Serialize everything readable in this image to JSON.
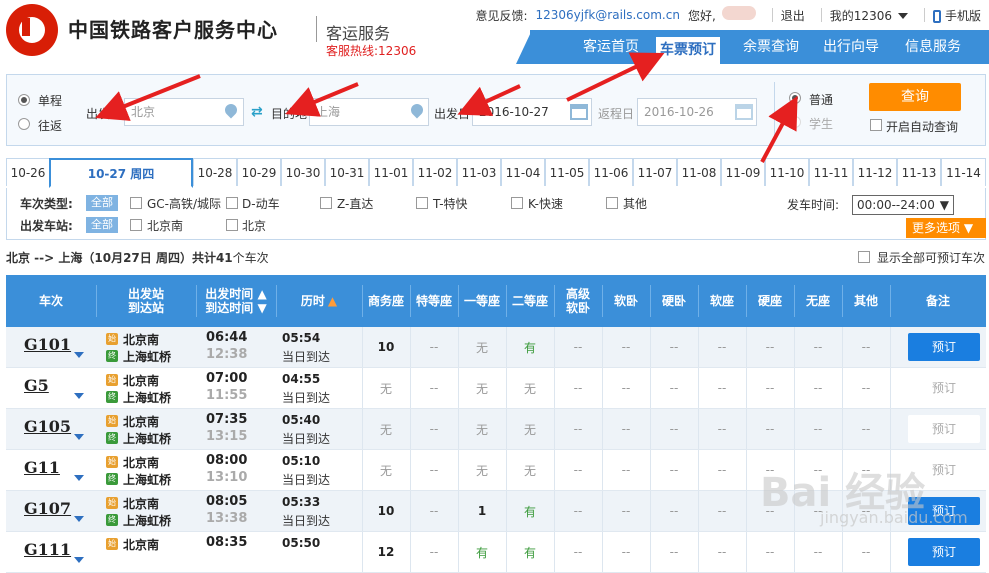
{
  "header": {
    "title": "中国铁路客户服务中心",
    "subtitle": "客运服务",
    "hotline": "客服热线:12306",
    "feedback_label": "意见反馈:",
    "feedback_email": "12306yjfk@rails.com.cn",
    "greeting": "您好,",
    "logout": "退出",
    "my12306": "我的12306",
    "mobile": "手机版"
  },
  "nav": {
    "items": [
      "客运首页",
      "车票预订",
      "余票查询",
      "出行向导",
      "信息服务"
    ],
    "active": "车票预订"
  },
  "search": {
    "trip_types": [
      "单程",
      "往返"
    ],
    "from_label": "出发地",
    "from_value": "北京",
    "to_label": "目的地",
    "to_value": "上海",
    "date_label": "出发日",
    "date_value": "2016-10-27",
    "return_label": "返程日",
    "return_value": "2016-10-26",
    "passenger_types": [
      "普通",
      "学生"
    ],
    "query_button": "查询",
    "auto_query": "开启自动查询"
  },
  "date_tabs": [
    "10-26",
    "10-27 周四",
    "10-28",
    "10-29",
    "10-30",
    "10-31",
    "11-01",
    "11-02",
    "11-03",
    "11-04",
    "11-05",
    "11-06",
    "11-07",
    "11-08",
    "11-09",
    "11-10",
    "11-11",
    "11-12",
    "11-13",
    "11-14"
  ],
  "filters": {
    "train_type_label": "车次类型:",
    "all": "全部",
    "train_types": [
      "GC-高铁/城际",
      "D-动车",
      "Z-直达",
      "T-特快",
      "K-快速",
      "其他"
    ],
    "station_label": "出发车站:",
    "stations": [
      "北京南",
      "北京"
    ],
    "time_label": "发车时间:",
    "time_value": "00:00--24:00",
    "more_options": "更多选项"
  },
  "summary": {
    "route": "北京 --> 上海（10月27日  周四）共计",
    "count": "41",
    "suffix": "个车次",
    "show_all": "显示全部可预订车次"
  },
  "table": {
    "headers": {
      "train": "车次",
      "station1": "出发站",
      "station2": "到达站",
      "time1": "出发时间",
      "time2": "到达时间",
      "duration": "历时",
      "seats": [
        "商务座",
        "特等座",
        "一等座",
        "二等座",
        "高级",
        "软卧",
        "软卧",
        "硬卧",
        "软座",
        "硬座",
        "无座",
        "其他"
      ],
      "note": "备注"
    },
    "rows": [
      {
        "train": "G101",
        "from": "北京南",
        "to": "上海虹桥",
        "dep": "06:44",
        "arr": "12:38",
        "dur": "05:54",
        "arr_note": "当日到达",
        "seats": [
          "10",
          "--",
          "无",
          "有",
          "--",
          "--",
          "--",
          "--",
          "--",
          "--",
          "--"
        ],
        "book": "预订",
        "bookable": true
      },
      {
        "train": "G5",
        "from": "北京南",
        "to": "上海虹桥",
        "dep": "07:00",
        "arr": "11:55",
        "dur": "04:55",
        "arr_note": "当日到达",
        "seats": [
          "无",
          "--",
          "无",
          "无",
          "--",
          "--",
          "--",
          "--",
          "--",
          "--",
          "--"
        ],
        "book": "预订",
        "bookable": false
      },
      {
        "train": "G105",
        "from": "北京南",
        "to": "上海虹桥",
        "dep": "07:35",
        "arr": "13:15",
        "dur": "05:40",
        "arr_note": "当日到达",
        "seats": [
          "无",
          "--",
          "无",
          "无",
          "--",
          "--",
          "--",
          "--",
          "--",
          "--",
          "--"
        ],
        "book": "预订",
        "bookable": false
      },
      {
        "train": "G11",
        "from": "北京南",
        "to": "上海虹桥",
        "dep": "08:00",
        "arr": "13:10",
        "dur": "05:10",
        "arr_note": "当日到达",
        "seats": [
          "无",
          "--",
          "无",
          "无",
          "--",
          "--",
          "--",
          "--",
          "--",
          "--",
          "--"
        ],
        "book": "预订",
        "bookable": false
      },
      {
        "train": "G107",
        "from": "北京南",
        "to": "上海虹桥",
        "dep": "08:05",
        "arr": "13:38",
        "dur": "05:33",
        "arr_note": "当日到达",
        "seats": [
          "10",
          "--",
          "1",
          "有",
          "--",
          "--",
          "--",
          "--",
          "--",
          "--",
          "--"
        ],
        "book": "预订",
        "bookable": true
      },
      {
        "train": "G111",
        "from": "北京南",
        "to": "",
        "dep": "08:35",
        "arr": "",
        "dur": "05:50",
        "arr_note": "",
        "seats": [
          "12",
          "--",
          "有",
          "有",
          "--",
          "--",
          "--",
          "--",
          "--",
          "--",
          "--"
        ],
        "book": "预订",
        "bookable": true
      }
    ]
  },
  "colors": {
    "brand_blue": "#3b8fd9",
    "orange": "#ff8c00",
    "red": "#d81e06",
    "green": "#3a9a3a"
  },
  "watermark": {
    "main": "Bai 经验",
    "sub": "jingyan.baidu.com"
  }
}
